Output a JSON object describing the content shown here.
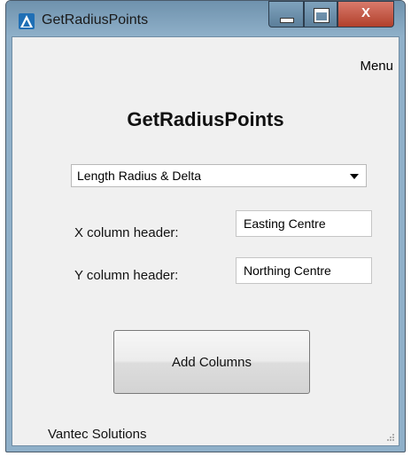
{
  "window": {
    "title": "GetRadiusPoints",
    "close_label": "X",
    "colors": {
      "frame": "#8fb0c9",
      "close": "#c0503b",
      "client": "#f0f0f0"
    }
  },
  "menu": {
    "label": "Menu"
  },
  "header": {
    "title": "GetRadiusPoints"
  },
  "mode_select": {
    "value": "Length Radius & Delta"
  },
  "fields": {
    "x_label": "X column header:",
    "x_value": "Easting Centre",
    "y_label": "Y column header:",
    "y_value": "Northing Centre"
  },
  "actions": {
    "add_columns": "Add Columns"
  },
  "footer": {
    "company": "Vantec Solutions"
  },
  "icons": {
    "app": "app-logo-icon",
    "minimize": "minimize-icon",
    "maximize": "maximize-icon",
    "close": "close-icon",
    "dropdown": "chevron-down-icon",
    "grip": "resize-grip-icon"
  }
}
